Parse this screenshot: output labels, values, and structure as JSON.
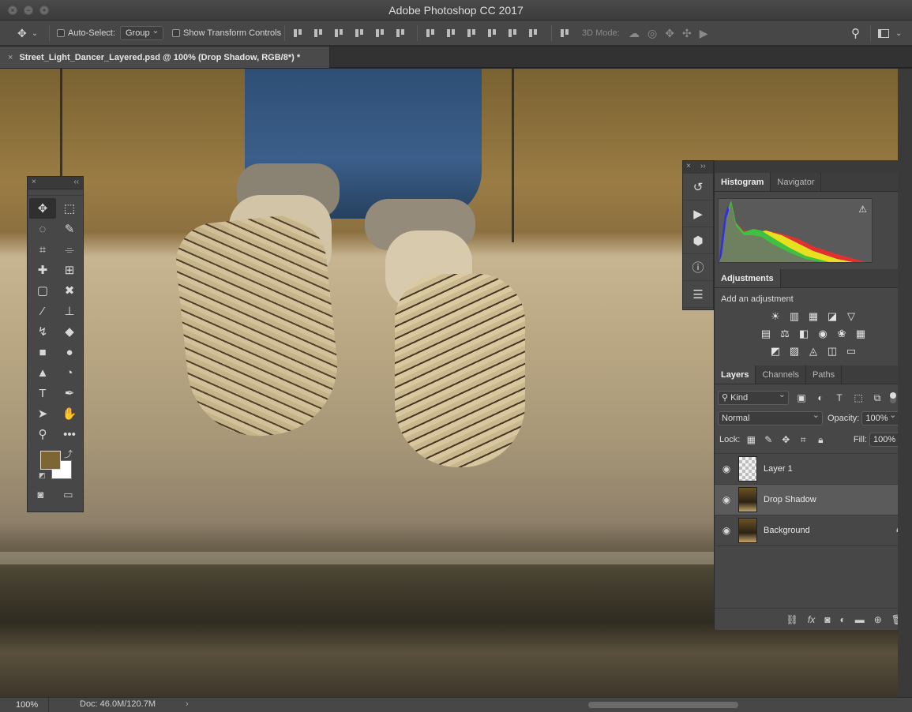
{
  "window": {
    "title": "Adobe Photoshop CC 2017"
  },
  "options_bar": {
    "auto_select_label": "Auto-Select:",
    "auto_select_value": "Group",
    "transform_label": "Show Transform Controls",
    "mode_3d_label": "3D Mode:"
  },
  "document": {
    "tab_title": "Street_Light_Dancer_Layered.psd @ 100% (Drop Shadow, RGB/8*) *"
  },
  "tools": {
    "items": [
      {
        "name": "move-tool-icon",
        "glyph": "✥",
        "active": true
      },
      {
        "name": "marquee-tool-icon",
        "glyph": "⬚",
        "active": false
      },
      {
        "name": "lasso-tool-icon",
        "glyph": "◌",
        "active": false
      },
      {
        "name": "quick-select-tool-icon",
        "glyph": "✎",
        "active": false
      },
      {
        "name": "crop-tool-icon",
        "glyph": "⌗",
        "active": false
      },
      {
        "name": "eyedropper-tool-icon",
        "glyph": "⌯",
        "active": false
      },
      {
        "name": "healing-brush-icon",
        "glyph": "✚",
        "active": false
      },
      {
        "name": "patch-tool-icon",
        "glyph": "⊞",
        "active": false
      },
      {
        "name": "frame-tool-icon",
        "glyph": "▢",
        "active": false
      },
      {
        "name": "content-aware-move-icon",
        "glyph": "✖",
        "active": false
      },
      {
        "name": "brush-tool-icon",
        "glyph": "⁄",
        "active": false
      },
      {
        "name": "stamp-tool-icon",
        "glyph": "⊥",
        "active": false
      },
      {
        "name": "history-brush-icon",
        "glyph": "↯",
        "active": false
      },
      {
        "name": "eraser-tool-icon",
        "glyph": "◆",
        "active": false
      },
      {
        "name": "gradient-tool-icon",
        "glyph": "■",
        "active": false
      },
      {
        "name": "blur-tool-icon",
        "glyph": "●",
        "active": false
      },
      {
        "name": "sharpen-tool-icon",
        "glyph": "▲",
        "active": false
      },
      {
        "name": "dodge-tool-icon",
        "glyph": "◔",
        "active": false
      },
      {
        "name": "type-tool-icon",
        "glyph": "T",
        "active": false
      },
      {
        "name": "pen-tool-icon",
        "glyph": "✒",
        "active": false
      },
      {
        "name": "path-select-tool-icon",
        "glyph": "➤",
        "active": false
      },
      {
        "name": "hand-tool-icon",
        "glyph": "✋",
        "active": false
      },
      {
        "name": "zoom-tool-icon",
        "glyph": "⚲",
        "active": false
      },
      {
        "name": "more-tools-icon",
        "glyph": "•••",
        "active": false
      }
    ],
    "foreground_color": "#7e6634",
    "background_color": "#ffffff"
  },
  "panels": {
    "top_tabs": [
      "Histogram",
      "Navigator"
    ],
    "adjustments_tab": "Adjustments",
    "adjustments_subtitle": "Add an adjustment",
    "adjustment_rows": [
      [
        "☀",
        "▥",
        "▦",
        "◪",
        "▽"
      ],
      [
        "▤",
        "⚖",
        "◧",
        "◉",
        "❀",
        "▦"
      ],
      [
        "◩",
        "▨",
        "◬",
        "◫",
        "▭"
      ]
    ],
    "layer_tabs": [
      "Layers",
      "Channels",
      "Paths"
    ],
    "filter_kind": "Kind",
    "blend_mode": "Normal",
    "opacity_label": "Opacity:",
    "opacity_value": "100%",
    "lock_label": "Lock:",
    "fill_label": "Fill:",
    "fill_value": "100%",
    "layers": [
      {
        "name": "Layer 1",
        "thumb": "checker",
        "selected": false,
        "locked": false
      },
      {
        "name": "Drop Shadow",
        "thumb": "photo",
        "selected": true,
        "locked": false
      },
      {
        "name": "Background",
        "thumb": "photo",
        "selected": false,
        "locked": true
      }
    ]
  },
  "status": {
    "zoom": "100%",
    "doc": "Doc: 46.0M/120.7M"
  },
  "colors": {
    "accent_panel": "#474747",
    "selected_layer": "#5b5b5b"
  }
}
